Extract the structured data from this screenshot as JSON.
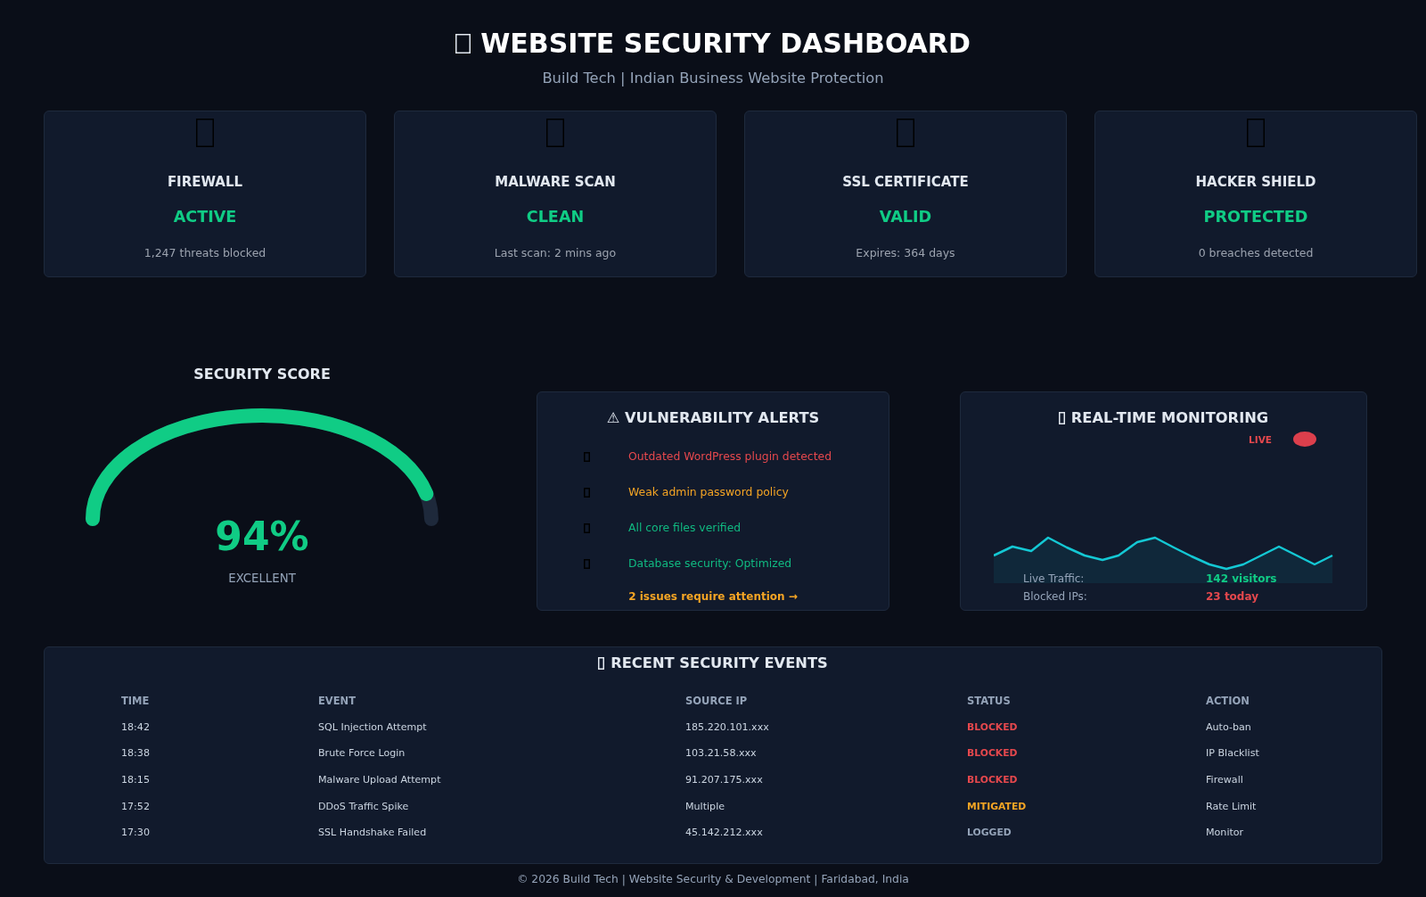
{
  "header": {
    "title": "WEBSITE SECURITY DASHBOARD",
    "subtitle": "Build Tech | Indian Business Website Protection"
  },
  "status_cards": [
    {
      "title": "FIREWALL",
      "status": "ACTIVE",
      "detail": "1,247 threats blocked"
    },
    {
      "title": "MALWARE SCAN",
      "status": "CLEAN",
      "detail": "Last scan: 2 mins ago"
    },
    {
      "title": "SSL CERTIFICATE",
      "status": "VALID",
      "detail": "Expires: 364 days"
    },
    {
      "title": "HACKER SHIELD",
      "status": "PROTECTED",
      "detail": "0 breaches detected"
    }
  ],
  "security_score": {
    "title": "SECURITY SCORE",
    "level": 0.94,
    "reading": "94%",
    "rating": "EXCELLENT"
  },
  "vulnerability_alerts": {
    "title": "⚠ VULNERABILITY ALERTS",
    "items": [
      {
        "text": "Outdated WordPress plugin detected",
        "color": "#e5484d"
      },
      {
        "text": "Weak admin password policy",
        "color": "#f5a524"
      },
      {
        "text": "All core files verified",
        "color": "#10b981"
      },
      {
        "text": "Database security: Optimized",
        "color": "#10b981"
      }
    ],
    "footer_link": "2 issues require attention →"
  },
  "monitoring": {
    "title": "REAL-TIME MONITORING",
    "live_label": "LIVE",
    "stats": [
      {
        "label": "Live Traffic:",
        "value": "142 visitors",
        "color": "#10cc85"
      },
      {
        "label": "Blocked IPs:",
        "value": "23 today",
        "color": "#e5484d"
      }
    ]
  },
  "events": {
    "title": "RECENT SECURITY EVENTS",
    "columns": [
      "TIME",
      "EVENT",
      "SOURCE IP",
      "STATUS",
      "ACTION"
    ],
    "rows": [
      {
        "time": "18:42",
        "event": "SQL Injection Attempt",
        "source_ip": "185.220.101.xxx",
        "status": {
          "text": "BLOCKED",
          "color": "#e5484d"
        },
        "action": "Auto-ban"
      },
      {
        "time": "18:38",
        "event": "Brute Force Login",
        "source_ip": "103.21.58.xxx",
        "status": {
          "text": "BLOCKED",
          "color": "#e5484d"
        },
        "action": "IP Blacklist"
      },
      {
        "time": "18:15",
        "event": "Malware Upload Attempt",
        "source_ip": "91.207.175.xxx",
        "status": {
          "text": "BLOCKED",
          "color": "#e5484d"
        },
        "action": "Firewall"
      },
      {
        "time": "17:52",
        "event": "DDoS Traffic Spike",
        "source_ip": "Multiple",
        "status": {
          "text": "MITIGATED",
          "color": "#f5a524"
        },
        "action": "Rate Limit"
      },
      {
        "time": "17:30",
        "event": "SSL Handshake Failed",
        "source_ip": "45.142.212.xxx",
        "status": {
          "text": "LOGGED",
          "color": "#94a3b8"
        },
        "action": "Monitor"
      }
    ]
  },
  "footer": "© 2026 Build Tech | Website Security & Development | Faridabad, India"
}
